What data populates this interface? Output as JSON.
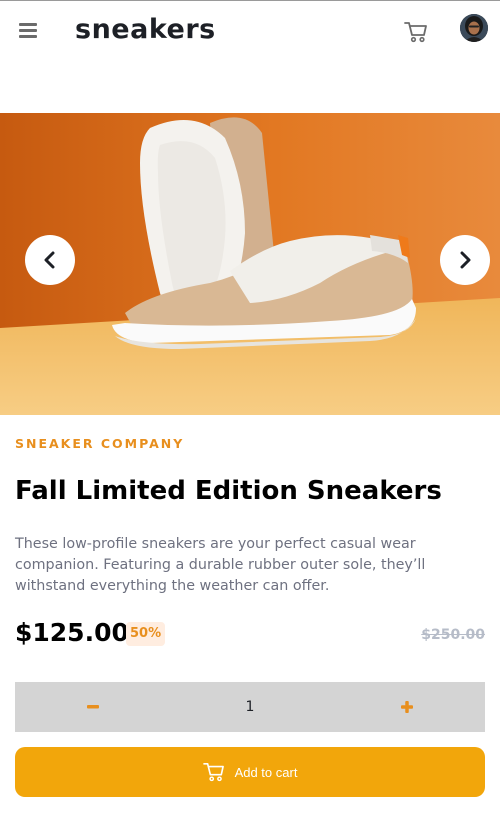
{
  "header": {
    "logo": "sneakers"
  },
  "icons": {
    "menu": "hamburger-menu-icon",
    "cart": "cart-icon",
    "avatar": "user-avatar",
    "prev": "chevron-left-icon",
    "next": "chevron-right-icon",
    "minus": "minus-icon",
    "plus": "plus-icon"
  },
  "product": {
    "company": "SNEAKER COMPANY",
    "title": "Fall Limited Edition Sneakers",
    "description": "These low-profile sneakers are your perfect casual wear companion. Featuring a durable rubber outer sole, they’ll withstand everything the weather can offer.",
    "price": "$125.00",
    "discount": "50%",
    "original_price": "$250.00"
  },
  "quantity": {
    "value": "1"
  },
  "actions": {
    "add_to_cart": "Add to cart"
  },
  "colors": {
    "accent": "#e88f1e",
    "button": "#f2a60b",
    "discount_bg": "#ffede0",
    "muted_text": "#6e7180",
    "strike_price": "#b6bcc8",
    "quantity_bg": "#d4d4d4"
  }
}
